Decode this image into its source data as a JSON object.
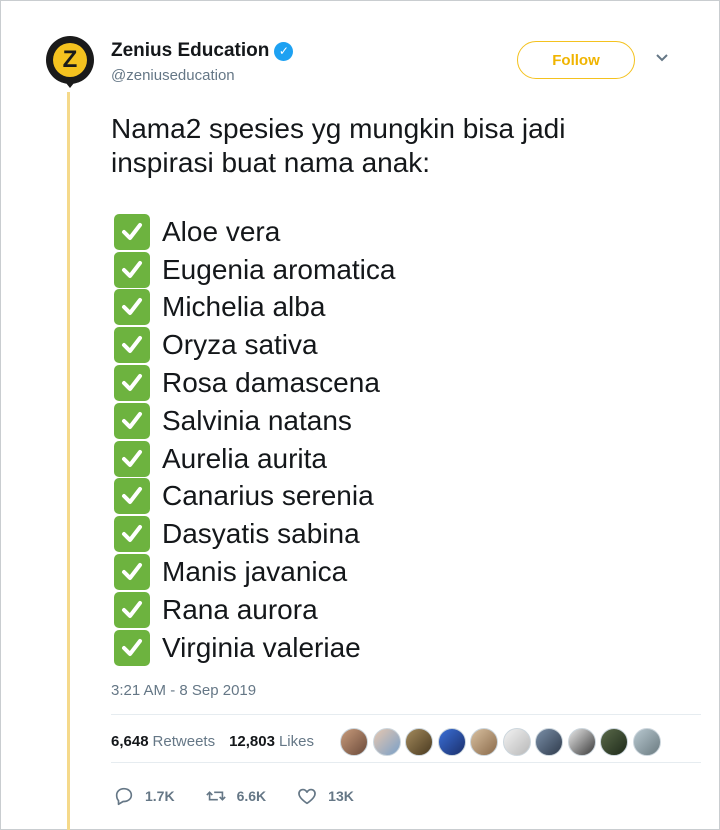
{
  "author": {
    "display_name": "Zenius Education",
    "handle": "@zeniuseducation",
    "avatar_letter": "Z",
    "verified_icon": "verified-badge-icon"
  },
  "follow_label": "Follow",
  "tweet": {
    "intro_line1": "Nama2 spesies yg mungkin bisa jadi",
    "intro_line2": "inspirasi buat nama anak:",
    "species": [
      "Aloe vera",
      "Eugenia aromatica",
      "Michelia alba",
      "Oryza sativa",
      "Rosa damascena",
      "Salvinia natans",
      "Aurelia aurita",
      "Canarius serenia",
      "Dasyatis sabina",
      "Manis javanica",
      "Rana aurora",
      "Virginia valeriae"
    ],
    "timestamp": "3:21 AM - 8 Sep 2019"
  },
  "stats": {
    "retweets_count": "6,648",
    "retweets_label": "Retweets",
    "likes_count": "12,803",
    "likes_label": "Likes"
  },
  "actions": {
    "reply_count": "1.7K",
    "retweet_count": "6.6K",
    "like_count": "13K"
  },
  "colors": {
    "accent": "#f4c21f",
    "check_green": "#6db33f",
    "muted": "#657786",
    "verified_blue": "#1da1f2"
  }
}
